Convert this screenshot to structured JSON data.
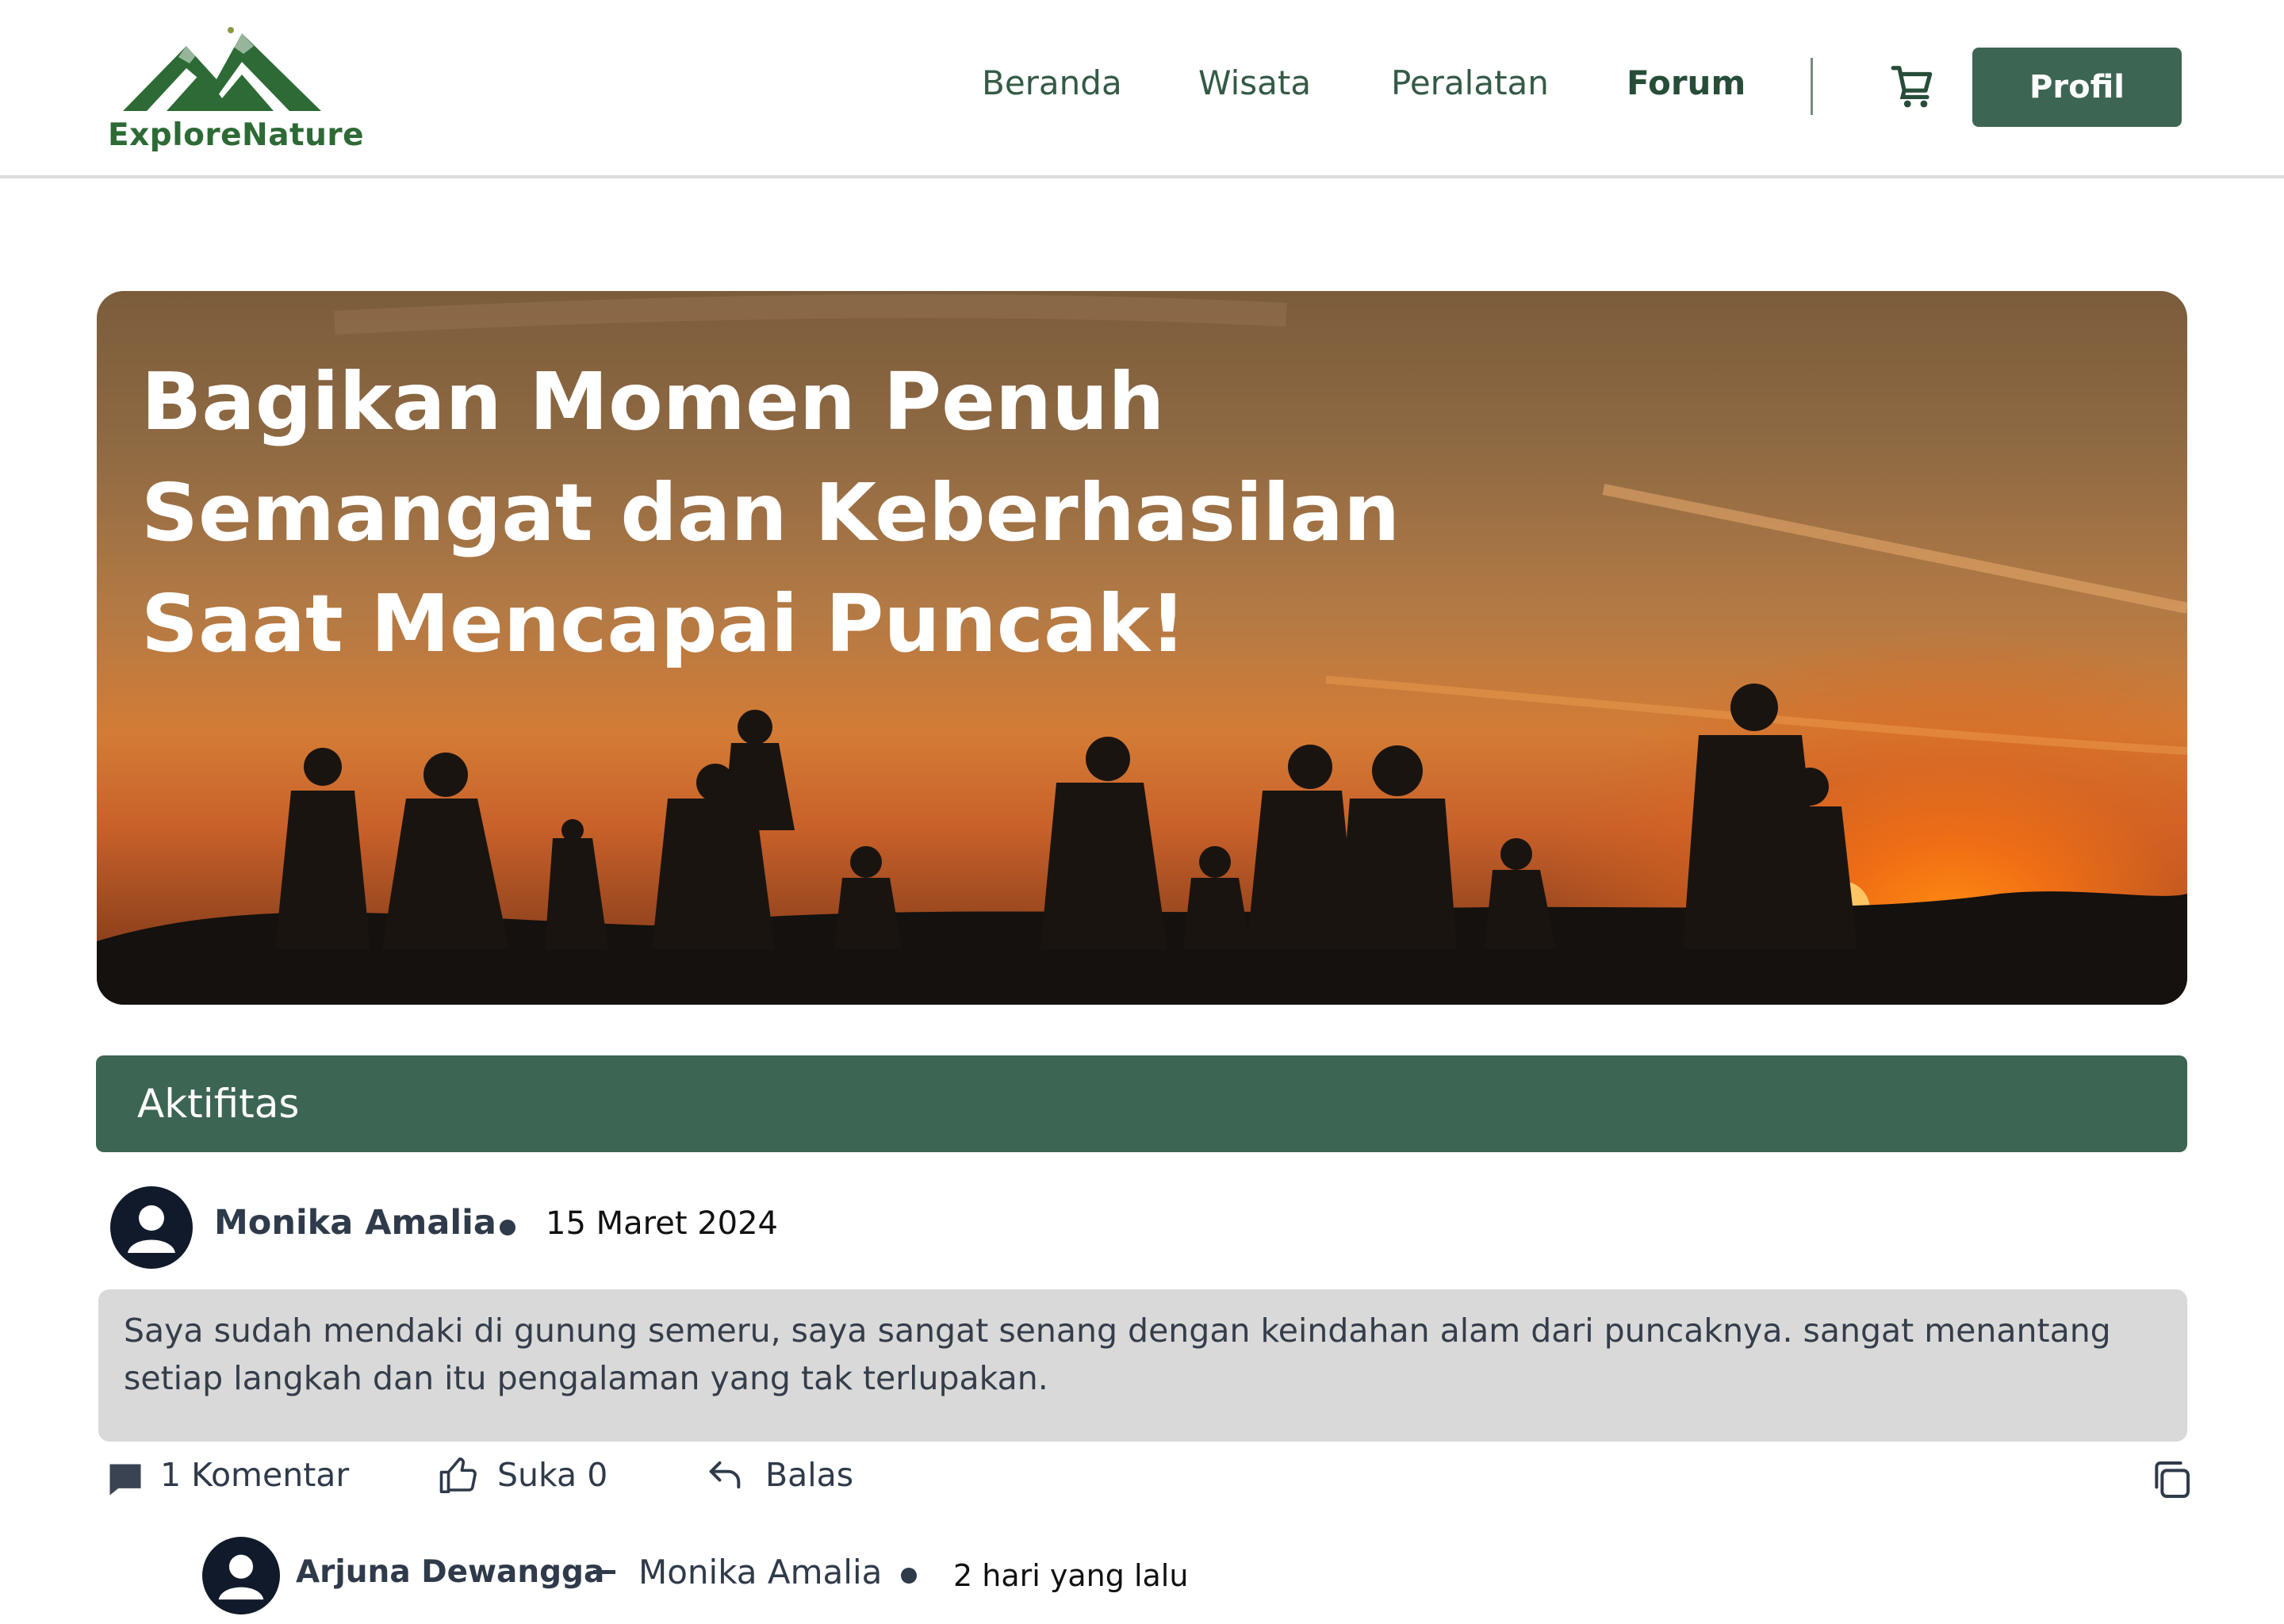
{
  "header": {
    "logo_text": "ExploreNature",
    "nav": [
      {
        "label": "Beranda",
        "active": false
      },
      {
        "label": "Wisata",
        "active": false
      },
      {
        "label": "Peralatan",
        "active": false
      },
      {
        "label": "Forum",
        "active": true
      }
    ],
    "cart_icon": "shopping-cart-icon",
    "profile_label": "Profil"
  },
  "hero": {
    "title_lines": [
      "Bagikan Momen Penuh",
      "Semangat dan Keberhasilan",
      "Saat Mencapai Puncak!"
    ]
  },
  "section": {
    "title": "Aktifitas"
  },
  "post": {
    "author": "Monika Amalia",
    "date": "15 Maret 2024",
    "body": "Saya sudah mendaki di gunung semeru, saya sangat senang dengan keindahan alam dari puncaknya. sangat menantang setiap langkah dan itu pengalaman yang tak terlupakan.",
    "actions": {
      "comments": "1 Komentar",
      "like": "Suka 0",
      "reply": "Balas"
    }
  },
  "reply": {
    "author": "Arjuna Dewangga",
    "reply_to": "Monika Amalia",
    "time": "2 hari yang lalu"
  },
  "colors": {
    "brand_green": "#3d6553",
    "logo_green": "#2d6a35",
    "post_bg": "#d9d9d9"
  }
}
